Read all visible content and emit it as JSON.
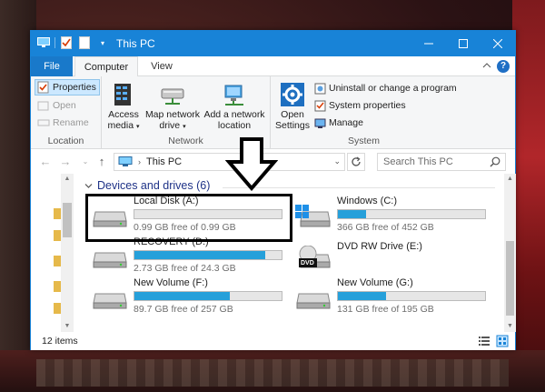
{
  "window": {
    "title": "This PC"
  },
  "ribbon_tabs": {
    "file": "File",
    "computer": "Computer",
    "view": "View"
  },
  "ribbon": {
    "location": {
      "label": "Location",
      "properties": "Properties",
      "open": "Open",
      "rename": "Rename"
    },
    "network": {
      "label": "Network",
      "access_media_1": "Access",
      "access_media_2": "media",
      "map_drive_1": "Map network",
      "map_drive_2": "drive",
      "add_location_1": "Add a network",
      "add_location_2": "location"
    },
    "system": {
      "label": "System",
      "open_settings_1": "Open",
      "open_settings_2": "Settings",
      "uninstall": "Uninstall or change a program",
      "system_properties": "System properties",
      "manage": "Manage"
    }
  },
  "address": {
    "path": "This PC",
    "search_placeholder": "Search This PC"
  },
  "group": {
    "title": "Devices and drives (6)"
  },
  "drives": [
    {
      "name": "Local Disk (A:)",
      "free": "0.99 GB free of 0.99 GB",
      "used_fraction": 0.0,
      "icon": "hdd-icon"
    },
    {
      "name": "Windows (C:)",
      "free": "366 GB free of 452 GB",
      "used_fraction": 0.19,
      "icon": "windows-drive-icon"
    },
    {
      "name": "RECOVERY (D:)",
      "free": "2.73 GB free of 24.3 GB",
      "used_fraction": 0.89,
      "icon": "hdd-icon"
    },
    {
      "name": "DVD RW Drive (E:)",
      "free": "",
      "used_fraction": null,
      "icon": "dvd-drive-icon",
      "icon_label": "DVD"
    },
    {
      "name": "New Volume (F:)",
      "free": "89.7 GB free of 257 GB",
      "used_fraction": 0.65,
      "icon": "hdd-icon"
    },
    {
      "name": "New Volume (G:)",
      "free": "131 GB free of 195 GB",
      "used_fraction": 0.33,
      "icon": "hdd-icon"
    }
  ],
  "status": {
    "items": "12 items"
  },
  "colors": {
    "titlebar": "#1883d7",
    "progress": "#26a0da",
    "group_header": "#1e3287"
  }
}
